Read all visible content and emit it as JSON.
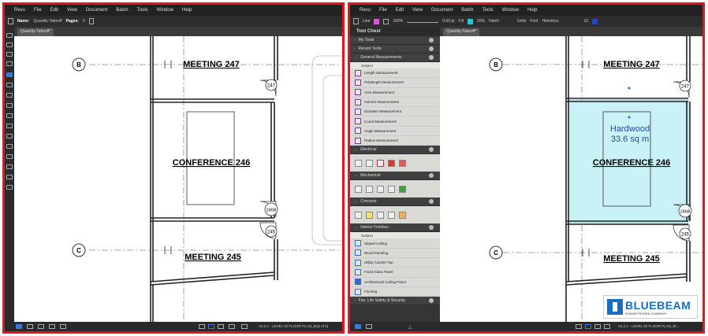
{
  "left": {
    "menu": [
      "Revu",
      "File",
      "Edit",
      "View",
      "Document",
      "Batch",
      "Tools",
      "Window",
      "Help"
    ],
    "toolbar": {
      "name_label": "Name:",
      "name_value": "Quantity-Takeoff",
      "pages_label": "Pages:",
      "pages_value": "5"
    },
    "tab": "Quantity-Takeoff*",
    "status": {
      "page_label": "A2.2.1 - LEVEL 02 FLOOR PLAN_IE...",
      "page_count": "(2 of 6)"
    }
  },
  "right": {
    "menu": [
      "Revu",
      "File",
      "Edit",
      "View",
      "Document",
      "Batch",
      "Tools",
      "Window",
      "Help"
    ],
    "toolbar": {
      "line_label": "Line",
      "zoom": "100%",
      "thickness": "0.60 pt",
      "fill_label": "Fill",
      "opacity": "20%",
      "hatch_label": "Hatch",
      "units_label": "Units",
      "font_label": "Font",
      "font_value": "Helvetica",
      "font_size": "12"
    },
    "tab": "Quantity-Takeoff*",
    "tool_chest": {
      "title": "Tool Chest",
      "categories": [
        "My Tools",
        "Recent Tools"
      ],
      "general": {
        "label": "General Measurements",
        "subject_header": "Subject",
        "items": [
          "Length Measurement",
          "Polylength Measurement",
          "Area Measurement",
          "Volume Measurement",
          "Diameter Measurement",
          "Count Measurement",
          "Angle Measurement",
          "Radius Measurement"
        ]
      },
      "electrical": "Electrical",
      "mechanical": "Mechanical",
      "concrete": "Concrete",
      "interior": {
        "label": "Interior Finishes",
        "subject_header": "Subject",
        "items": [
          "Sloped Ceiling",
          "Wood Paneling",
          "Utility Counter Top",
          "Fixed Glass Panel",
          "Architectural Ceiling Panel",
          "Flooring"
        ]
      },
      "fire": "Fire, Life Safety & Security"
    },
    "measurement": {
      "line1": "Hardwood",
      "line2": "33.6 sq m"
    },
    "status": {
      "page_label": "A2.2.1 - LEVEL 02 FLOOR PLAN_IE..."
    },
    "logo": {
      "brand": "BLUEBEAM",
      "tagline": "A NEMETSCHEK COMPANY"
    }
  },
  "plan": {
    "grid_b": "B",
    "grid_c": "C",
    "room_247": "MEETING  247",
    "room_246": "CONFERENCE  246",
    "room_245": "MEETING  245",
    "door_247": "247",
    "door_246b": "246B",
    "door_245": "245"
  },
  "colors": {
    "frame": "#e8141c",
    "accent": "#1a6dc2",
    "area_fill": "#c8f2f6"
  }
}
